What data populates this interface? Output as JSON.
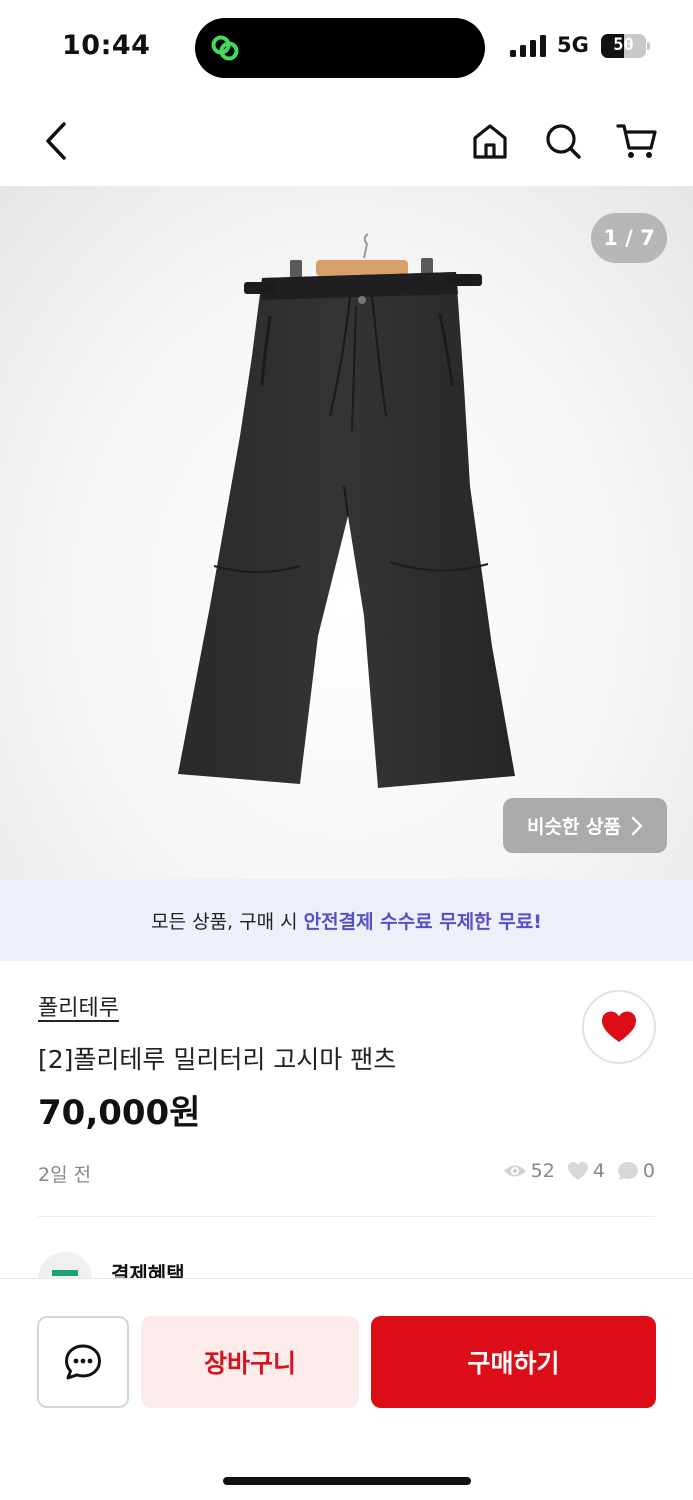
{
  "status_bar": {
    "time": "10:44",
    "network": "5G",
    "battery": "50",
    "battery_level": 0.5
  },
  "nav": {
    "icons": [
      "back-icon",
      "home-icon",
      "search-icon",
      "cart-icon"
    ]
  },
  "gallery": {
    "page_indicator": "1 / 7",
    "similar_label": "비슷한 상품",
    "current_page": 1,
    "total_pages": 7
  },
  "promo": {
    "text_prefix": "모든 상품, 구매 시",
    "text_highlight": "안전결제 수수료 무제한 무료!",
    "highlight_color": "#5650c8"
  },
  "product": {
    "brand": "폴리테루",
    "title": "[2]폴리테루 밀리터리 고시마 팬츠",
    "price": "70,000원",
    "posted": "2일 전",
    "views": "52",
    "likes": "4",
    "chats": "0",
    "liked": true
  },
  "benefit": {
    "label": "결제혜택"
  },
  "actions": {
    "cart_label": "장바구니",
    "buy_label": "구매하기",
    "accent_color": "#dc0d16"
  }
}
